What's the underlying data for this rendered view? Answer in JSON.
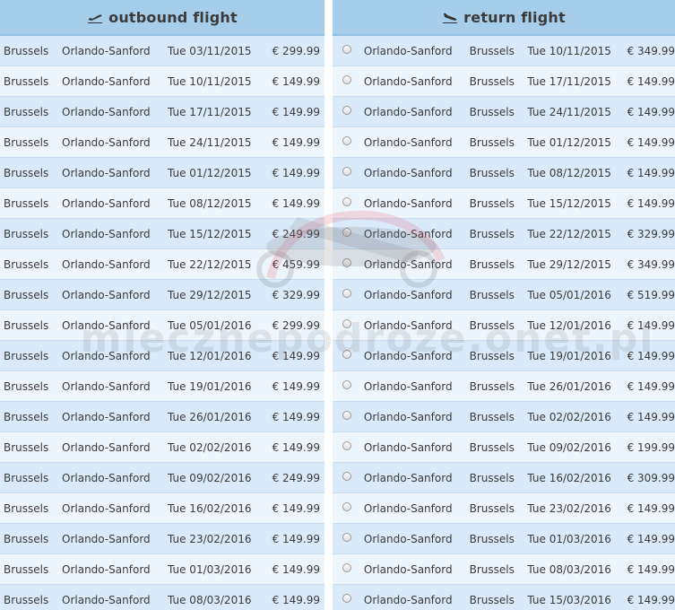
{
  "outbound": {
    "title": "outbound flight",
    "plane_icon": "plane-takeoff-icon",
    "rows": [
      {
        "from": "Brussels",
        "to": "Orlando-Sanford",
        "date": "Tue 03/11/2015",
        "price": "€ 299.99"
      },
      {
        "from": "Brussels",
        "to": "Orlando-Sanford",
        "date": "Tue 10/11/2015",
        "price": "€ 149.99"
      },
      {
        "from": "Brussels",
        "to": "Orlando-Sanford",
        "date": "Tue 17/11/2015",
        "price": "€ 149.99"
      },
      {
        "from": "Brussels",
        "to": "Orlando-Sanford",
        "date": "Tue 24/11/2015",
        "price": "€ 149.99"
      },
      {
        "from": "Brussels",
        "to": "Orlando-Sanford",
        "date": "Tue 01/12/2015",
        "price": "€ 149.99"
      },
      {
        "from": "Brussels",
        "to": "Orlando-Sanford",
        "date": "Tue 08/12/2015",
        "price": "€ 149.99"
      },
      {
        "from": "Brussels",
        "to": "Orlando-Sanford",
        "date": "Tue 15/12/2015",
        "price": "€ 249.99"
      },
      {
        "from": "Brussels",
        "to": "Orlando-Sanford",
        "date": "Tue 22/12/2015",
        "price": "€ 459.99"
      },
      {
        "from": "Brussels",
        "to": "Orlando-Sanford",
        "date": "Tue 29/12/2015",
        "price": "€ 329.99"
      },
      {
        "from": "Brussels",
        "to": "Orlando-Sanford",
        "date": "Tue 05/01/2016",
        "price": "€ 299.99"
      },
      {
        "from": "Brussels",
        "to": "Orlando-Sanford",
        "date": "Tue 12/01/2016",
        "price": "€ 149.99"
      },
      {
        "from": "Brussels",
        "to": "Orlando-Sanford",
        "date": "Tue 19/01/2016",
        "price": "€ 149.99"
      },
      {
        "from": "Brussels",
        "to": "Orlando-Sanford",
        "date": "Tue 26/01/2016",
        "price": "€ 149.99"
      },
      {
        "from": "Brussels",
        "to": "Orlando-Sanford",
        "date": "Tue 02/02/2016",
        "price": "€ 149.99"
      },
      {
        "from": "Brussels",
        "to": "Orlando-Sanford",
        "date": "Tue 09/02/2016",
        "price": "€ 249.99"
      },
      {
        "from": "Brussels",
        "to": "Orlando-Sanford",
        "date": "Tue 16/02/2016",
        "price": "€ 149.99"
      },
      {
        "from": "Brussels",
        "to": "Orlando-Sanford",
        "date": "Tue 23/02/2016",
        "price": "€ 149.99"
      },
      {
        "from": "Brussels",
        "to": "Orlando-Sanford",
        "date": "Tue 01/03/2016",
        "price": "€ 149.99"
      },
      {
        "from": "Brussels",
        "to": "Orlando-Sanford",
        "date": "Tue 08/03/2016",
        "price": "€ 149.99"
      }
    ]
  },
  "return": {
    "title": "return flight",
    "plane_icon": "plane-landing-icon",
    "rows": [
      {
        "from": "Orlando-Sanford",
        "to": "Brussels",
        "date": "Tue 10/11/2015",
        "price": "€ 349.99"
      },
      {
        "from": "Orlando-Sanford",
        "to": "Brussels",
        "date": "Tue 17/11/2015",
        "price": "€ 149.99"
      },
      {
        "from": "Orlando-Sanford",
        "to": "Brussels",
        "date": "Tue 24/11/2015",
        "price": "€ 149.99"
      },
      {
        "from": "Orlando-Sanford",
        "to": "Brussels",
        "date": "Tue 01/12/2015",
        "price": "€ 149.99"
      },
      {
        "from": "Orlando-Sanford",
        "to": "Brussels",
        "date": "Tue 08/12/2015",
        "price": "€ 149.99"
      },
      {
        "from": "Orlando-Sanford",
        "to": "Brussels",
        "date": "Tue 15/12/2015",
        "price": "€ 149.99"
      },
      {
        "from": "Orlando-Sanford",
        "to": "Brussels",
        "date": "Tue 22/12/2015",
        "price": "€ 329.99"
      },
      {
        "from": "Orlando-Sanford",
        "to": "Brussels",
        "date": "Tue 29/12/2015",
        "price": "€ 349.99"
      },
      {
        "from": "Orlando-Sanford",
        "to": "Brussels",
        "date": "Tue 05/01/2016",
        "price": "€ 519.99"
      },
      {
        "from": "Orlando-Sanford",
        "to": "Brussels",
        "date": "Tue 12/01/2016",
        "price": "€ 149.99"
      },
      {
        "from": "Orlando-Sanford",
        "to": "Brussels",
        "date": "Tue 19/01/2016",
        "price": "€ 149.99"
      },
      {
        "from": "Orlando-Sanford",
        "to": "Brussels",
        "date": "Tue 26/01/2016",
        "price": "€ 149.99"
      },
      {
        "from": "Orlando-Sanford",
        "to": "Brussels",
        "date": "Tue 02/02/2016",
        "price": "€ 149.99"
      },
      {
        "from": "Orlando-Sanford",
        "to": "Brussels",
        "date": "Tue 09/02/2016",
        "price": "€ 199.99"
      },
      {
        "from": "Orlando-Sanford",
        "to": "Brussels",
        "date": "Tue 16/02/2016",
        "price": "€ 309.99"
      },
      {
        "from": "Orlando-Sanford",
        "to": "Brussels",
        "date": "Tue 23/02/2016",
        "price": "€ 149.99"
      },
      {
        "from": "Orlando-Sanford",
        "to": "Brussels",
        "date": "Tue 01/03/2016",
        "price": "€ 149.99"
      },
      {
        "from": "Orlando-Sanford",
        "to": "Brussels",
        "date": "Tue 08/03/2016",
        "price": "€ 149.99"
      },
      {
        "from": "Orlando-Sanford",
        "to": "Brussels",
        "date": "Tue 15/03/2016",
        "price": "€ 149.99"
      }
    ]
  },
  "watermark": {
    "text": "mlecznepodroze.onet.pl"
  },
  "colors": {
    "header_bg": "#a6cdea",
    "row_odd": "#d9eafa",
    "row_even": "#eef6fd"
  }
}
